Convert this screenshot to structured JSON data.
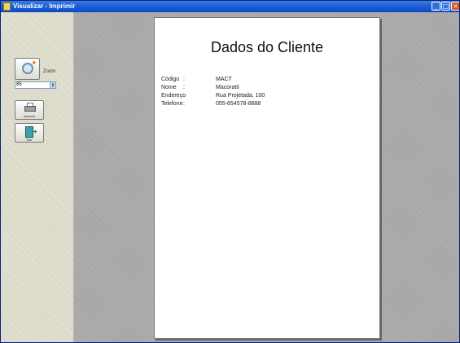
{
  "window": {
    "title": "Visualizar - Imprimir",
    "buttons": {
      "minimize": "_",
      "maximize": "□",
      "close": "×"
    }
  },
  "toolbar": {
    "zoom_label": "Zoom",
    "zoom_value": "85",
    "print_label": "Imprimir",
    "exit_label": "Sair",
    "icons": {
      "zoom": "magnifier-icon",
      "print": "printer-icon",
      "exit": "exit-door-icon"
    }
  },
  "report": {
    "title": "Dados do Cliente",
    "fields": [
      {
        "label": "Código",
        "sep": ":",
        "value": "MACT"
      },
      {
        "label": "Nome",
        "sep": ":",
        "value": "Macoratti"
      },
      {
        "label": "Endereço",
        "sep": ":",
        "value": "Rua Projetada, 100"
      },
      {
        "label": "Telefone",
        "sep": ":",
        "value": "055-654578-8888"
      }
    ]
  },
  "colors": {
    "titlebar": "#0a4bc4",
    "preview_background": "#a8a8a8",
    "sidebar_background": "#e6e4d4",
    "page": "#ffffff"
  }
}
